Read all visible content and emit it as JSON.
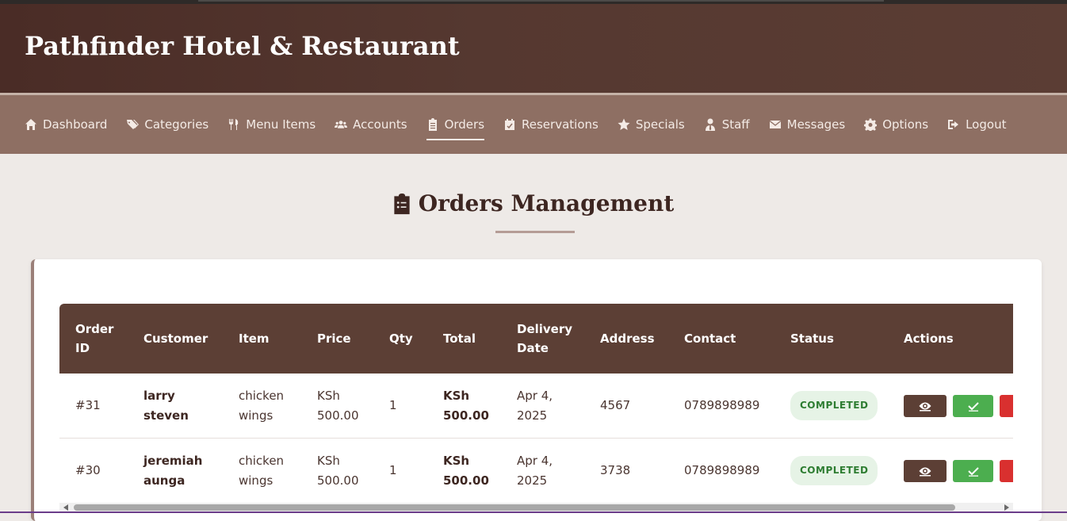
{
  "brand": {
    "title": "Pathfinder Hotel & Restaurant"
  },
  "nav": {
    "items": [
      {
        "label": "Dashboard",
        "icon": "home-icon"
      },
      {
        "label": "Categories",
        "icon": "tags-icon"
      },
      {
        "label": "Menu Items",
        "icon": "utensils-icon"
      },
      {
        "label": "Accounts",
        "icon": "users-icon"
      },
      {
        "label": "Orders",
        "icon": "clipboard-list-icon",
        "active": true
      },
      {
        "label": "Reservations",
        "icon": "calendar-check-icon"
      },
      {
        "label": "Specials",
        "icon": "star-icon"
      },
      {
        "label": "Staff",
        "icon": "user-tie-icon"
      },
      {
        "label": "Messages",
        "icon": "envelope-icon"
      },
      {
        "label": "Options",
        "icon": "gear-icon"
      },
      {
        "label": "Logout",
        "icon": "sign-out-icon"
      }
    ]
  },
  "page": {
    "title": "Orders Management"
  },
  "table": {
    "headers": {
      "order_id_1": "Order",
      "order_id_2": "ID",
      "customer": "Customer",
      "item": "Item",
      "price": "Price",
      "qty": "Qty",
      "total": "Total",
      "delivery_1": "Delivery",
      "delivery_2": "Date",
      "address": "Address",
      "contact": "Contact",
      "status": "Status",
      "actions": "Actions"
    },
    "rows": [
      {
        "id": "#31",
        "customer_1": "larry",
        "customer_2": "steven",
        "item_1": "chicken",
        "item_2": "wings",
        "price_1": "KSh",
        "price_2": "500.00",
        "qty": "1",
        "total_1": "KSh",
        "total_2": "500.00",
        "date_1": "Apr 4,",
        "date_2": "2025",
        "address": "4567",
        "contact": "0789898989",
        "status": "COMPLETED"
      },
      {
        "id": "#30",
        "customer_1": "jeremiah",
        "customer_2": "aunga",
        "item_1": "chicken",
        "item_2": "wings",
        "price_1": "KSh",
        "price_2": "500.00",
        "qty": "1",
        "total_1": "KSh",
        "total_2": "500.00",
        "date_1": "Apr 4,",
        "date_2": "2025",
        "address": "3738",
        "contact": "0789898989",
        "status": "COMPLETED"
      }
    ]
  },
  "colors": {
    "header_bg": "#4a2c26",
    "nav_bg": "#8e6f63",
    "table_header_bg": "#5c3f35",
    "status_completed": "#2e7d32",
    "btn_complete": "#4cae4f",
    "btn_delete": "#d9302f"
  }
}
